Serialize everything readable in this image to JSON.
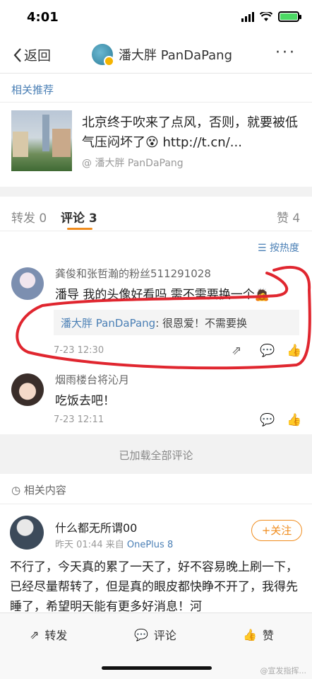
{
  "status_bar": {
    "time": "4:01"
  },
  "nav": {
    "back_label": "返回",
    "title": "潘大胖 PanDaPang",
    "more": "···"
  },
  "recommend": {
    "label": "相关推荐",
    "text": "北京终于吹来了点风，否则，就要被低气压闷坏了😵 http://t.cn/...",
    "source": "@ 潘大胖 PanDaPang"
  },
  "tabs": {
    "repost": "转发 0",
    "comment": "评论 3",
    "like": "赞 4"
  },
  "sort_label": "按热度",
  "comments": [
    {
      "name": "龚俊和张哲瀚的粉丝511291028",
      "text": "潘导 我的头像好看吗 需不需要换一个🙇",
      "reply_name": "潘大胖 PanDaPang",
      "reply_text": ": 很恩爱！不需要换",
      "time": "7-23 12:30"
    },
    {
      "name": "烟雨楼台将沁月",
      "text": "吃饭去吧！",
      "time": "7-23 12:11"
    }
  ],
  "loaded_all": "已加载全部评论",
  "related": {
    "label": "相关内容",
    "user": "什么都无所谓00",
    "meta_time": "昨天 01:44 来自 ",
    "device": "OnePlus 8",
    "follow": "+关注",
    "text": "不行了，今天真的累了一天了，好不容易晚上刷一下，已经尽量帮转了，但是真的眼皮都快睁不开了，我得先睡了，希望明天能有更多好消息！河"
  },
  "bottom_bar": {
    "repost": "转发",
    "comment": "评论",
    "like": "赞"
  },
  "watermark": "@宣发指挥..."
}
